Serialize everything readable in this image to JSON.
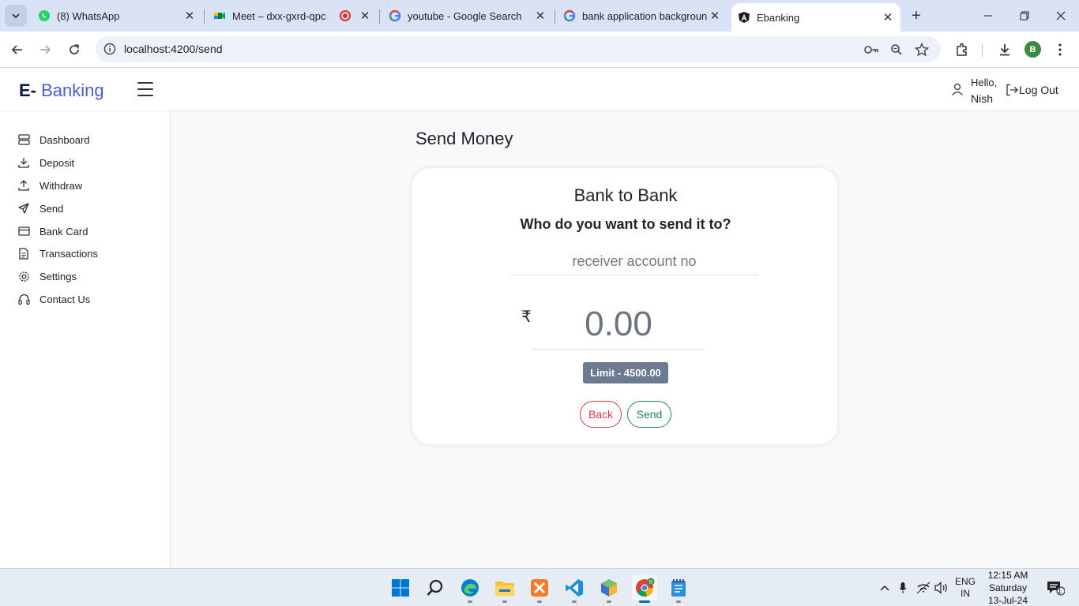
{
  "browser": {
    "tabs": [
      {
        "title": "(8) WhatsApp",
        "icon": "whatsapp-icon"
      },
      {
        "title": "Meet – dxx-gxrd-qpc",
        "icon": "google-meet-icon"
      },
      {
        "title": "youtube - Google Search",
        "icon": "google-icon"
      },
      {
        "title": "bank application backgroun",
        "icon": "google-icon"
      },
      {
        "title": "Ebanking",
        "icon": "angular-icon"
      }
    ],
    "url": "localhost:4200/send",
    "profile_initial": "B"
  },
  "app": {
    "brand_prefix": "E-",
    "brand_name": "Banking",
    "greeting": "Hello,",
    "user_name": "Nish",
    "logout_label": "Log Out"
  },
  "sidebar": {
    "items": [
      {
        "label": "Dashboard",
        "icon": "dashboard-icon"
      },
      {
        "label": "Deposit",
        "icon": "download-icon"
      },
      {
        "label": "Withdraw",
        "icon": "upload-icon"
      },
      {
        "label": "Send",
        "icon": "send-icon"
      },
      {
        "label": "Bank Card",
        "icon": "card-icon"
      },
      {
        "label": "Transactions",
        "icon": "document-icon"
      },
      {
        "label": "Settings",
        "icon": "gear-icon"
      },
      {
        "label": "Contact Us",
        "icon": "headset-icon"
      }
    ]
  },
  "main": {
    "page_title": "Send Money",
    "card_title": "Bank to Bank",
    "question": "Who do you want to send it to?",
    "account_placeholder": "receiver account no",
    "currency_symbol": "₹",
    "amount_placeholder": "0.00",
    "limit_label": "Limit - 4500.00",
    "back_label": "Back",
    "send_label": "Send"
  },
  "taskbar": {
    "language": "ENG",
    "region": "IN",
    "time": "12:15 AM",
    "day": "Saturday",
    "date": "13-Jul-24",
    "notification_count": "1"
  },
  "colors": {
    "brand_dark": "#0b1847",
    "brand_accent": "#4c5bd4",
    "back_button": "#dc3545",
    "send_button": "#198754",
    "limit_badge": "#6c7a92"
  }
}
